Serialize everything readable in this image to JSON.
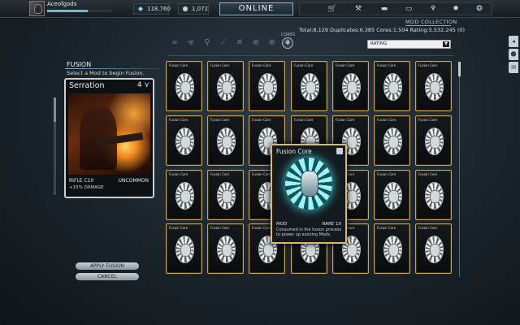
{
  "header": {
    "username": "Aceofgods",
    "xp_progress": 0.62,
    "platinum": "118,760",
    "credits": "1,072",
    "online_label": "ONLINE",
    "nav_icons": [
      "cart-icon",
      "foundry-icon",
      "arsenal-icon",
      "market-icon",
      "lamp-icon",
      "settings-icon",
      "options-icon"
    ]
  },
  "collection": {
    "title": "MOD COLLECTION",
    "stats": "Total:8,129  Duplicates:6,385  Cores:1,504  Rating:5,532,245 (0)",
    "cores_label": "CORES",
    "sort_value": "RATING",
    "filter_icons": [
      "infinity-icon",
      "biohazard-icon",
      "warframe-icon",
      "claw-icon",
      "crossed-blades-icon",
      "sentinel-icon",
      "rifle-icon",
      "cores-icon"
    ]
  },
  "fusion": {
    "title": "FUSION",
    "subtitle": "Select a Mod to begin Fusion.",
    "apply_label": "APPLY FUSION",
    "cancel_label": "CANCEL"
  },
  "selected_mod": {
    "name": "Serration",
    "drain": "4",
    "type": "RIFLE",
    "rank": "C10",
    "rarity": "UNCOMMON",
    "effect": "+15% DAMAGE"
  },
  "grid": {
    "card_label": "Fusion Core",
    "rows": 4,
    "cols": 7
  },
  "tooltip": {
    "name": "Fusion Core",
    "type": "MOD",
    "rarity": "RARE 10",
    "description": "Consumed in the fusion process to power up existing Mods."
  },
  "side_tabs": [
    "chat-icon",
    "profile-icon",
    "inbox-icon"
  ]
}
